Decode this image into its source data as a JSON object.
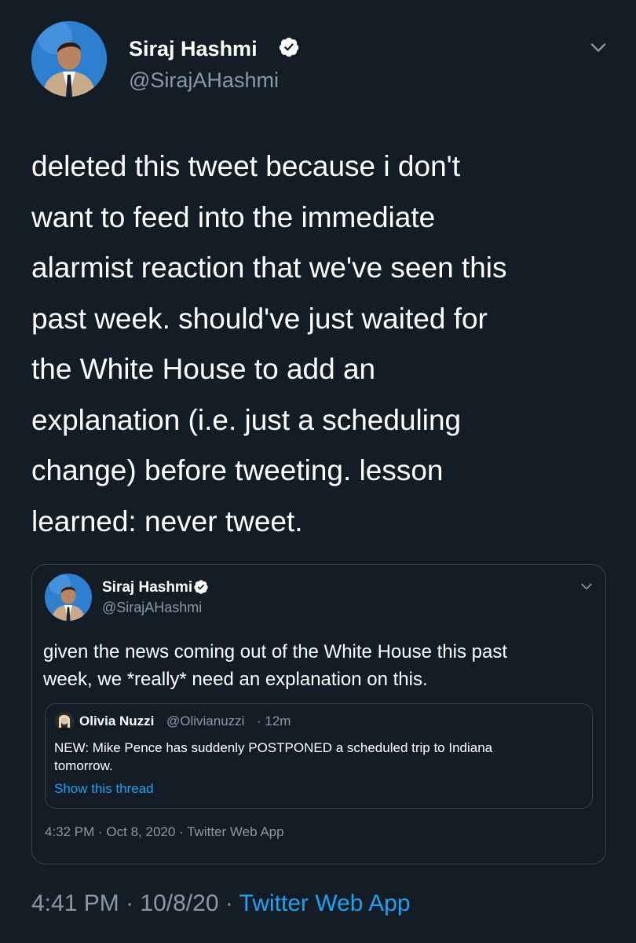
{
  "tweet": {
    "author_name": "Siraj Hashmi",
    "author_handle": "@SirajAHashmi",
    "text": "deleted this tweet because i don't\nwant to feed into the immediate\nalarmist reaction that we've seen this\npast week. should've just waited for\nthe White House to add an\nexplanation (i.e. just a scheduling\nchange) before tweeting. lesson\nlearned: never tweet.",
    "time": "4:41 PM",
    "sep1": "·",
    "date": "10/8/20",
    "sep2": "·",
    "source": "Twitter Web App"
  },
  "quoted": {
    "author_name": "Siraj Hashmi",
    "author_handle": "@SirajAHashmi",
    "text_line1": "given the news coming out of the White House this past",
    "text_line2": "week, we *really* need an explanation on this.",
    "meta": "4:32 PM · Oct 8, 2020 · Twitter Web App",
    "nested": {
      "author_name": "Olivia Nuzzi",
      "author_handle": "@Olivianuzzi",
      "age": "· 12m",
      "text_line1": "NEW: Mike Pence has suddenly POSTPONED a scheduled trip to Indiana",
      "text_line2": "tomorrow.",
      "show_thread": "Show this thread"
    }
  },
  "icons": {
    "verified": "verified-badge-icon",
    "more": "chevron-down-icon"
  },
  "colors": {
    "background": "#141d26",
    "border": "#38444d",
    "secondary_text": "#8899a6",
    "link": "#1da1f2"
  }
}
